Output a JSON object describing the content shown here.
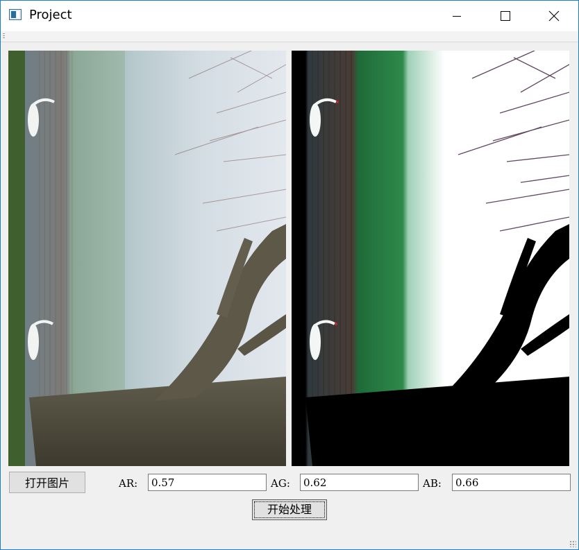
{
  "window": {
    "title": "Project",
    "accent": "#1e7cc8"
  },
  "icons": {
    "app": "app-window-icon",
    "minimize": "minimize-icon",
    "maximize": "maximize-icon",
    "close": "close-icon"
  },
  "images": {
    "original": {
      "description_name": "original-image"
    },
    "processed": {
      "description_name": "processed-image"
    }
  },
  "controls": {
    "open_button_label": "打开图片",
    "ar_label": "AR:",
    "ar_value": "0.57",
    "ag_label": "AG:",
    "ag_value": "0.62",
    "ab_label": "AB:",
    "ab_value": "0.66",
    "process_button_label": "开始处理"
  }
}
